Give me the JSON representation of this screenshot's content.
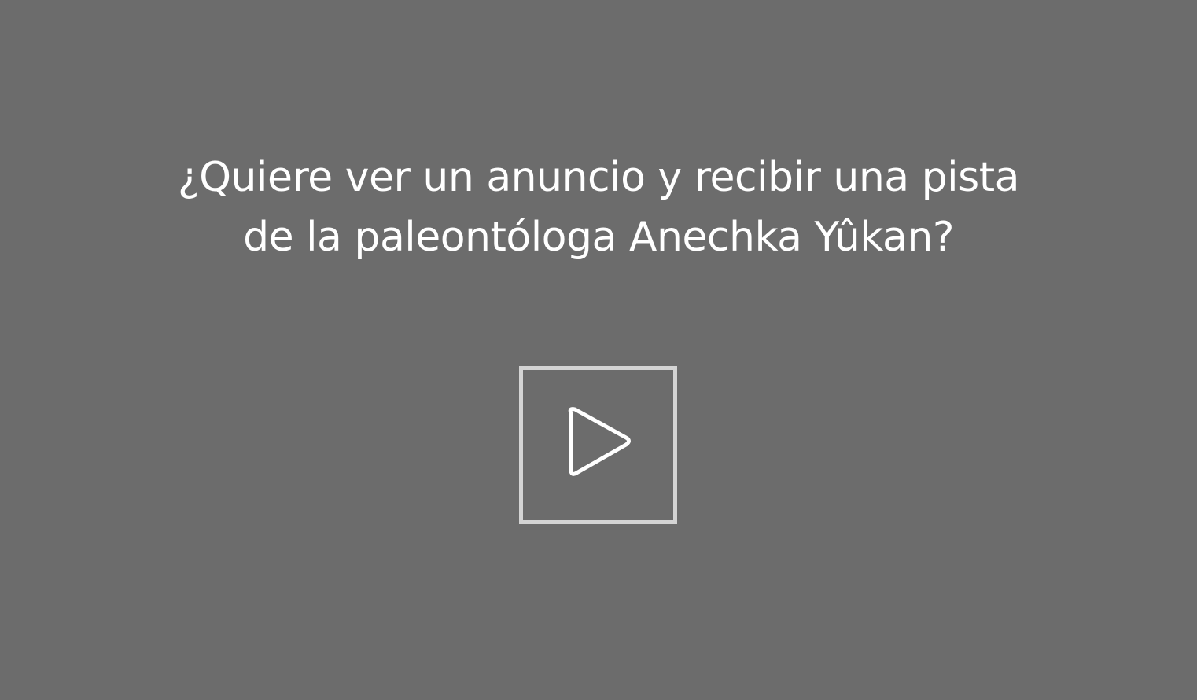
{
  "prompt": {
    "line1": "¿Quiere ver un anuncio y recibir una pista",
    "line2": "de la paleontóloga Anechka Yûkan?"
  },
  "play_button": {
    "icon": "play-icon"
  },
  "colors": {
    "background": "#6c6c6c",
    "text": "#ffffff",
    "button_border": "#d4d4d4",
    "icon_stroke": "#ffffff"
  }
}
